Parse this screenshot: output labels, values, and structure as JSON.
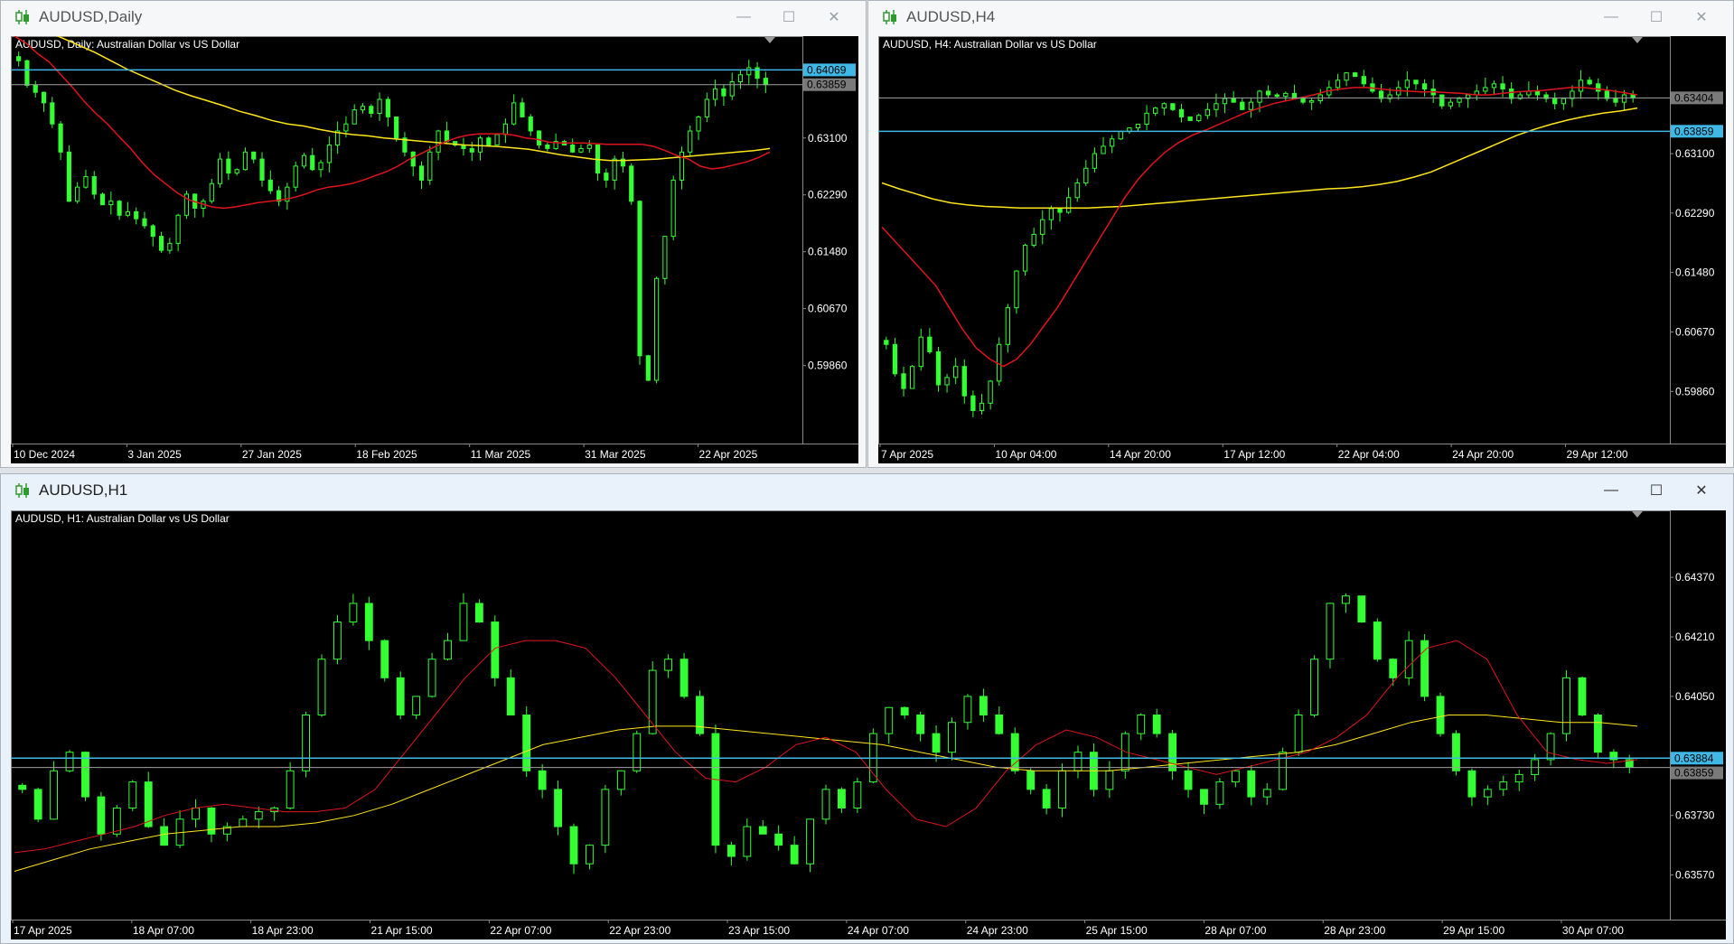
{
  "windows": [
    {
      "id": "daily",
      "title": "AUDUSD,Daily",
      "chart_label": "AUDUSD, Daily:  Australian Dollar vs US Dollar",
      "active": false
    },
    {
      "id": "h4",
      "title": "AUDUSD,H4",
      "chart_label": "AUDUSD, H4:  Australian Dollar vs US Dollar",
      "active": false
    },
    {
      "id": "h1",
      "title": "AUDUSD,H1",
      "chart_label": "AUDUSD, H1:  Australian Dollar vs US Dollar",
      "active": true
    }
  ],
  "buttons": {
    "minimize": "—",
    "maximize": "☐",
    "close": "✕"
  },
  "colors": {
    "background": "#000000",
    "candle": "#33ff33",
    "ma_fast": "#e0141b",
    "ma_slow": "#ffe51a",
    "level_line": "#3fb8e6",
    "bid_line": "#a0a0a0",
    "axis_text": "#ffffff"
  },
  "chart_data": [
    {
      "type": "candlestick",
      "title": "AUDUSD, Daily:  Australian Dollar vs US Dollar",
      "x_ticks": [
        "10 Dec 2024",
        "3 Jan 2025",
        "27 Jan 2025",
        "18 Feb 2025",
        "11 Mar 2025",
        "31 Mar 2025",
        "22 Apr 2025"
      ],
      "y_ticks": [
        0.631,
        0.6229,
        0.6148,
        0.6067,
        0.5986
      ],
      "ylim": [
        0.5875,
        0.6455
      ],
      "current_price": 0.63859,
      "level_line": 0.64069,
      "price_labels": [
        "0.64069",
        "0.63859"
      ],
      "closes": [
        0.642,
        0.6385,
        0.6375,
        0.636,
        0.633,
        0.629,
        0.622,
        0.624,
        0.6255,
        0.623,
        0.6215,
        0.622,
        0.62,
        0.6205,
        0.6195,
        0.6185,
        0.617,
        0.615,
        0.616,
        0.62,
        0.623,
        0.621,
        0.622,
        0.6245,
        0.628,
        0.626,
        0.6265,
        0.629,
        0.628,
        0.625,
        0.6235,
        0.622,
        0.624,
        0.627,
        0.6285,
        0.6265,
        0.6275,
        0.63,
        0.632,
        0.633,
        0.635,
        0.6355,
        0.6345,
        0.6365,
        0.634,
        0.631,
        0.629,
        0.627,
        0.625,
        0.629,
        0.632,
        0.6305,
        0.63,
        0.6295,
        0.629,
        0.631,
        0.63,
        0.6315,
        0.633,
        0.636,
        0.634,
        0.632,
        0.63,
        0.6295,
        0.6305,
        0.63,
        0.629,
        0.6295,
        0.63,
        0.626,
        0.625,
        0.628,
        0.627,
        0.622,
        0.6,
        0.5965,
        0.611,
        0.617,
        0.625,
        0.629,
        0.632,
        0.634,
        0.6365,
        0.638,
        0.637,
        0.639,
        0.64,
        0.641,
        0.6395,
        0.6386
      ],
      "ma_fast": [
        0.6455,
        0.6445,
        0.643,
        0.6418,
        0.64,
        0.6382,
        0.6362,
        0.6345,
        0.633,
        0.6312,
        0.6295,
        0.6275,
        0.6258,
        0.6245,
        0.6232,
        0.6222,
        0.6217,
        0.6212,
        0.621,
        0.6212,
        0.6215,
        0.6218,
        0.622,
        0.6222,
        0.6225,
        0.623,
        0.6236,
        0.624,
        0.6242,
        0.6245,
        0.625,
        0.6256,
        0.6262,
        0.627,
        0.628,
        0.6288,
        0.6296,
        0.6304,
        0.631,
        0.6314,
        0.6316,
        0.6316,
        0.6316,
        0.6314,
        0.631,
        0.6308,
        0.6304,
        0.6303,
        0.6303,
        0.6303,
        0.6302,
        0.6301,
        0.6301,
        0.6301,
        0.6301,
        0.6298,
        0.6292,
        0.6285,
        0.628,
        0.627,
        0.6266,
        0.6268,
        0.6272,
        0.6276,
        0.6282,
        0.629
      ],
      "ma_slow": [
        0.6475,
        0.647,
        0.6462,
        0.6452,
        0.6442,
        0.6432,
        0.642,
        0.6408,
        0.6398,
        0.6388,
        0.6378,
        0.637,
        0.6363,
        0.6356,
        0.6348,
        0.6342,
        0.6335,
        0.633,
        0.6327,
        0.6322,
        0.6318,
        0.6315,
        0.6313,
        0.631,
        0.6308,
        0.6306,
        0.6304,
        0.6302,
        0.63,
        0.6299,
        0.6298,
        0.6296,
        0.6294,
        0.629,
        0.6286,
        0.6283,
        0.628,
        0.6278,
        0.6278,
        0.6279,
        0.628,
        0.6282,
        0.6284,
        0.6286,
        0.6288,
        0.629,
        0.6292,
        0.6295
      ]
    },
    {
      "type": "candlestick",
      "title": "AUDUSD, H4:  Australian Dollar vs US Dollar",
      "x_ticks": [
        "7 Apr 2025",
        "10 Apr 04:00",
        "14 Apr 20:00",
        "17 Apr 12:00",
        "22 Apr 04:00",
        "24 Apr 20:00",
        "29 Apr 12:00"
      ],
      "y_ticks": [
        0.631,
        0.6229,
        0.6148,
        0.6067,
        0.5986
      ],
      "ylim": [
        0.5915,
        0.647
      ],
      "current_price": 0.63859,
      "level_line": 0.63404,
      "price_labels": [
        "0.63859",
        "0.63404"
      ],
      "closes": [
        0.605,
        0.601,
        0.599,
        0.602,
        0.606,
        0.604,
        0.5995,
        0.6005,
        0.602,
        0.598,
        0.596,
        0.597,
        0.6,
        0.605,
        0.61,
        0.615,
        0.6185,
        0.62,
        0.622,
        0.6235,
        0.623,
        0.625,
        0.627,
        0.629,
        0.631,
        0.632,
        0.633,
        0.634,
        0.6345,
        0.635,
        0.6365,
        0.6372,
        0.6378,
        0.637,
        0.636,
        0.6355,
        0.6362,
        0.637,
        0.6378,
        0.6385,
        0.638,
        0.637,
        0.638,
        0.6395,
        0.639,
        0.6388,
        0.6392,
        0.6385,
        0.638,
        0.6382,
        0.639,
        0.64,
        0.641,
        0.642,
        0.6415,
        0.6405,
        0.6395,
        0.6385,
        0.639,
        0.64,
        0.641,
        0.6405,
        0.6398,
        0.639,
        0.6375,
        0.638,
        0.6385,
        0.639,
        0.6395,
        0.64,
        0.6405,
        0.6398,
        0.6385,
        0.639,
        0.6395,
        0.639,
        0.6385,
        0.6378,
        0.6385,
        0.6395,
        0.641,
        0.6405,
        0.6395,
        0.6385,
        0.638,
        0.639,
        0.6386
      ],
      "ma_fast": [
        0.621,
        0.619,
        0.617,
        0.615,
        0.613,
        0.61,
        0.607,
        0.6045,
        0.603,
        0.602,
        0.603,
        0.605,
        0.6075,
        0.61,
        0.613,
        0.616,
        0.619,
        0.622,
        0.625,
        0.6275,
        0.6295,
        0.6312,
        0.6325,
        0.6335,
        0.6342,
        0.635,
        0.6358,
        0.6366,
        0.6372,
        0.6378,
        0.6382,
        0.6386,
        0.639,
        0.6395,
        0.6398,
        0.64,
        0.64,
        0.6398,
        0.6396,
        0.6395,
        0.6394,
        0.6394,
        0.6393,
        0.6392,
        0.639,
        0.639,
        0.6392,
        0.6394,
        0.6395,
        0.6396,
        0.6398,
        0.64,
        0.64,
        0.6398,
        0.6396,
        0.6393,
        0.639
      ],
      "ma_slow": [
        0.627,
        0.6262,
        0.6255,
        0.6248,
        0.6243,
        0.624,
        0.6238,
        0.6237,
        0.6236,
        0.6236,
        0.6236,
        0.6236,
        0.6236,
        0.6237,
        0.6238,
        0.624,
        0.6242,
        0.6244,
        0.6246,
        0.6248,
        0.625,
        0.6252,
        0.6254,
        0.6256,
        0.6258,
        0.626,
        0.6262,
        0.6263,
        0.6265,
        0.6268,
        0.6272,
        0.6278,
        0.6285,
        0.6295,
        0.6305,
        0.6315,
        0.6325,
        0.6335,
        0.6343,
        0.635,
        0.6356,
        0.6361,
        0.6365,
        0.6368,
        0.6372
      ]
    },
    {
      "type": "candlestick",
      "title": "AUDUSD, H1:  Australian Dollar vs US Dollar",
      "x_ticks": [
        "17 Apr 2025",
        "18 Apr 07:00",
        "18 Apr 23:00",
        "21 Apr 15:00",
        "22 Apr 07:00",
        "22 Apr 23:00",
        "23 Apr 15:00",
        "24 Apr 07:00",
        "24 Apr 23:00",
        "25 Apr 15:00",
        "28 Apr 07:00",
        "28 Apr 23:00",
        "29 Apr 15:00",
        "30 Apr 07:00"
      ],
      "y_ticks": [
        0.6437,
        0.6421,
        0.6405,
        0.6373,
        0.6357
      ],
      "ylim": [
        0.6345,
        0.6455
      ],
      "current_price": 0.63859,
      "level_line": 0.63884,
      "price_labels": [
        "0.63884",
        "0.63859"
      ],
      "closes": [
        0.638,
        0.6372,
        0.6385,
        0.639,
        0.6378,
        0.6368,
        0.6375,
        0.6382,
        0.637,
        0.6365,
        0.6372,
        0.6375,
        0.6368,
        0.637,
        0.6372,
        0.6374,
        0.6375,
        0.6385,
        0.64,
        0.6415,
        0.6425,
        0.643,
        0.642,
        0.641,
        0.64,
        0.6405,
        0.6415,
        0.642,
        0.643,
        0.6425,
        0.641,
        0.64,
        0.6385,
        0.638,
        0.637,
        0.636,
        0.6365,
        0.638,
        0.6385,
        0.6395,
        0.6412,
        0.6415,
        0.6405,
        0.6395,
        0.6365,
        0.6362,
        0.637,
        0.6368,
        0.6365,
        0.636,
        0.6372,
        0.638,
        0.6375,
        0.6382,
        0.6395,
        0.6402,
        0.64,
        0.6395,
        0.639,
        0.6398,
        0.6405,
        0.64,
        0.6395,
        0.6385,
        0.638,
        0.6375,
        0.6385,
        0.639,
        0.638,
        0.6385,
        0.6395,
        0.64,
        0.6395,
        0.6385,
        0.638,
        0.6376,
        0.6382,
        0.6385,
        0.6378,
        0.638,
        0.639,
        0.64,
        0.6415,
        0.643,
        0.6432,
        0.6425,
        0.6415,
        0.641,
        0.642,
        0.6405,
        0.6395,
        0.6385,
        0.6378,
        0.638,
        0.6382,
        0.6384,
        0.6388,
        0.6395,
        0.641,
        0.64,
        0.639,
        0.6388,
        0.6386
      ],
      "ma_fast": [
        0.6363,
        0.6364,
        0.6366,
        0.6368,
        0.637,
        0.6373,
        0.6375,
        0.6376,
        0.6375,
        0.6374,
        0.6374,
        0.6375,
        0.638,
        0.639,
        0.64,
        0.641,
        0.6418,
        0.642,
        0.642,
        0.6418,
        0.641,
        0.64,
        0.639,
        0.6383,
        0.6382,
        0.6386,
        0.6392,
        0.6394,
        0.639,
        0.638,
        0.6372,
        0.637,
        0.6375,
        0.6385,
        0.6392,
        0.6396,
        0.6394,
        0.639,
        0.6388,
        0.6386,
        0.6384,
        0.6386,
        0.6388,
        0.639,
        0.6394,
        0.64,
        0.641,
        0.6418,
        0.642,
        0.6415,
        0.64,
        0.639,
        0.6388,
        0.6387,
        0.6388
      ],
      "ma_slow": [
        0.6358,
        0.6361,
        0.6364,
        0.6366,
        0.6368,
        0.6369,
        0.637,
        0.637,
        0.6371,
        0.6373,
        0.6376,
        0.638,
        0.6384,
        0.6388,
        0.6392,
        0.6394,
        0.6396,
        0.6397,
        0.6397,
        0.6396,
        0.6395,
        0.6394,
        0.6393,
        0.6392,
        0.639,
        0.6388,
        0.6386,
        0.6385,
        0.6385,
        0.6385,
        0.6386,
        0.6387,
        0.6388,
        0.6389,
        0.639,
        0.6392,
        0.6395,
        0.6398,
        0.64,
        0.64,
        0.6399,
        0.6398,
        0.6398,
        0.6397
      ]
    }
  ]
}
